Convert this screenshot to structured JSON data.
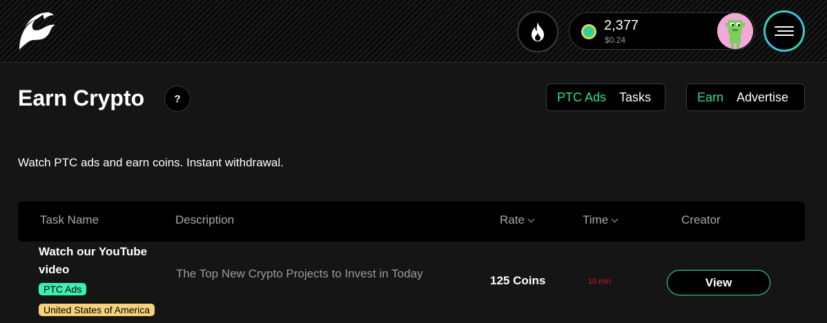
{
  "header": {
    "logo_icon": "flame-leaf-logo",
    "fire_icon": "fire-icon",
    "wallet": {
      "coin_icon": "coin-icon",
      "amount": "2,377",
      "usd": "$0.24"
    },
    "avatar_icon": "pixel-avatar",
    "menu_icon": "hamburger-menu-icon"
  },
  "page": {
    "title": "Earn Crypto",
    "help_label": "?",
    "subtitle": "Watch PTC ads and earn coins. Instant withdrawal."
  },
  "type_toggle": {
    "options": [
      "PTC Ads",
      "Tasks"
    ],
    "active": "PTC Ads"
  },
  "mode_toggle": {
    "options": [
      "Earn",
      "Advertise"
    ],
    "active": "Earn"
  },
  "table": {
    "columns": [
      "Task Name",
      "Description",
      "Rate",
      "Time",
      "Creator"
    ],
    "rows": [
      {
        "task_name": "Watch our YouTube video",
        "type_badge": "PTC Ads",
        "country_badge": "United States of America",
        "description": "The Top New Crypto Projects to Invest in Today",
        "rate": "125 Coins",
        "time": "10 min",
        "action": "View"
      }
    ]
  },
  "colors": {
    "accent": "#2ee08b",
    "badge_type": "#3ef0b0",
    "badge_country": "#f7d27a",
    "time": "#e11818"
  }
}
